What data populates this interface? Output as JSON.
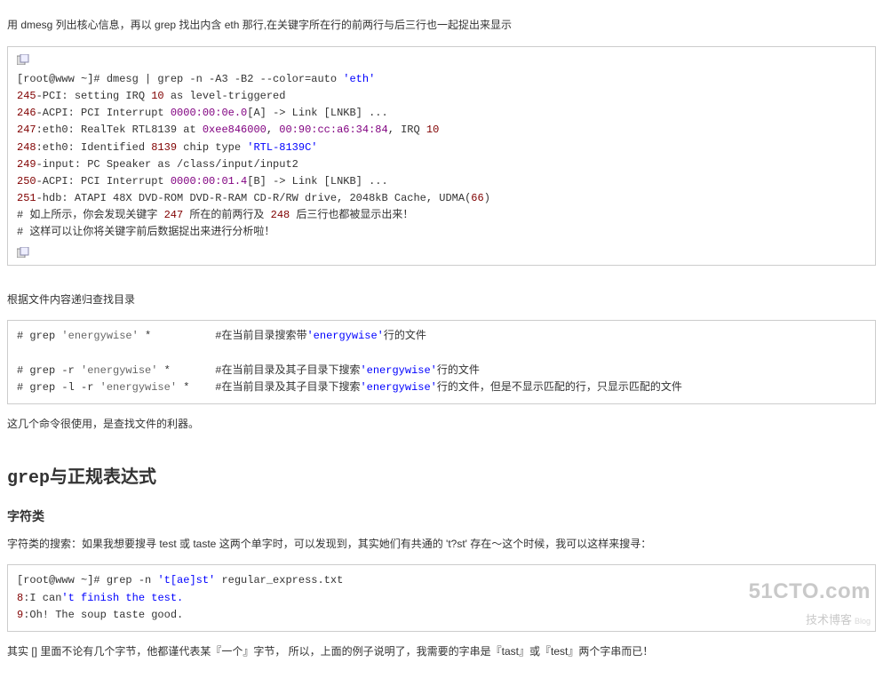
{
  "intro1": "用 dmesg 列出核心信息，再以 grep 找出内含 eth 那行,在关键字所在行的前两行与后三行也一起捉出来显示",
  "block1": {
    "line1_pre": "[root@www ~]# dmesg | grep -n -A3 -B2 --color=auto ",
    "line1_str": "'eth'",
    "l2_num": "245",
    "l2_rest": "-PCI: setting IRQ ",
    "l2_irq": "10",
    "l2_tail": " as level-triggered",
    "l3_num": "246",
    "l3_rest": "-ACPI: PCI Interrupt ",
    "l3_addr": "0000:00:0e.0",
    "l3_tail": "[A] -> Link [LNKB] ...",
    "l4_num": "247",
    "l4_rest": ":eth0: RealTek RTL8139 at ",
    "l4_hex": "0xee846000",
    "l4_mid": ", ",
    "l4_mac": "00:90:cc:a6:34:84",
    "l4_tail": ", IRQ ",
    "l4_irq": "10",
    "l5_num": "248",
    "l5_rest": ":eth0: Identified ",
    "l5_chip": "8139",
    "l5_mid": " chip type ",
    "l5_str": "'RTL-8139C'",
    "l6_num": "249",
    "l6_rest": "-input: PC Speaker as /class/input/input2",
    "l7_num": "250",
    "l7_rest": "-ACPI: PCI Interrupt ",
    "l7_addr": "0000:00:01.4",
    "l7_tail": "[B] -> Link [LNKB] ...",
    "l8_num": "251",
    "l8_rest": "-hdb: ATAPI 48X DVD-ROM DVD-R-RAM CD-R/RW drive, 2048kB Cache, UDMA(",
    "l8_udma": "66",
    "l8_close": ")",
    "c1a": "# 如上所示，你会发现关键字 ",
    "c1_247": "247",
    "c1b": " 所在的前两行及 ",
    "c1_248": "248",
    "c1c": " 后三行也都被显示出来！",
    "c2": "# 这样可以让你将关键字前后数据捉出来进行分析啦！"
  },
  "intro2": "根据文件内容递归查找目录",
  "block2": {
    "l1_cmd": "# grep ",
    "l1_arg": "'energywise'",
    "l1_glob": " *          ",
    "l1_cmt_a": "#在当前目录搜索带",
    "l1_cmt_kw": "'energywise'",
    "l1_cmt_b": "行的文件",
    "blank": " ",
    "l2_cmd": "# grep -r ",
    "l2_arg": "'energywise'",
    "l2_glob": " *       ",
    "l2_cmt_a": "#在当前目录及其子目录下搜索",
    "l2_cmt_kw": "'energywise'",
    "l2_cmt_b": "行的文件",
    "l3_cmd": "# grep -l -r ",
    "l3_arg": "'energywise'",
    "l3_glob": " *    ",
    "l3_cmt_a": "#在当前目录及其子目录下搜索",
    "l3_cmt_kw": "'energywise'",
    "l3_cmt_b": "行的文件，但是不显示匹配的行，只显示匹配的文件"
  },
  "para3": "这几个命令很使用，是查找文件的利器。",
  "h2_a": "grep",
  "h2_b": "与正规表达式",
  "h3_1": "字符类",
  "para4": "字符类的搜索：如果我想要搜寻 test 或 taste 这两个单字时，可以发现到，其实她们有共通的 't?st' 存在～这个时候，我可以这样来搜寻：",
  "block3": {
    "l1_pre": "[root@www ~]# grep -n ",
    "l1_str": "'t[ae]st'",
    "l1_tail": " regular_express.txt",
    "l2_num": "8",
    "l2_rest": ":I can",
    "l2_str": "'t finish the test.",
    "l3_num": "9",
    "l3_rest": ":Oh! The soup taste good."
  },
  "para5": "其实 [] 里面不论有几个字节，他都谨代表某『一个』字节， 所以，上面的例子说明了，我需要的字串是『tast』或『test』两个字串而已！",
  "watermark": {
    "main": "51CTO.com",
    "sub": "技术博客",
    "blog": "Blog"
  }
}
